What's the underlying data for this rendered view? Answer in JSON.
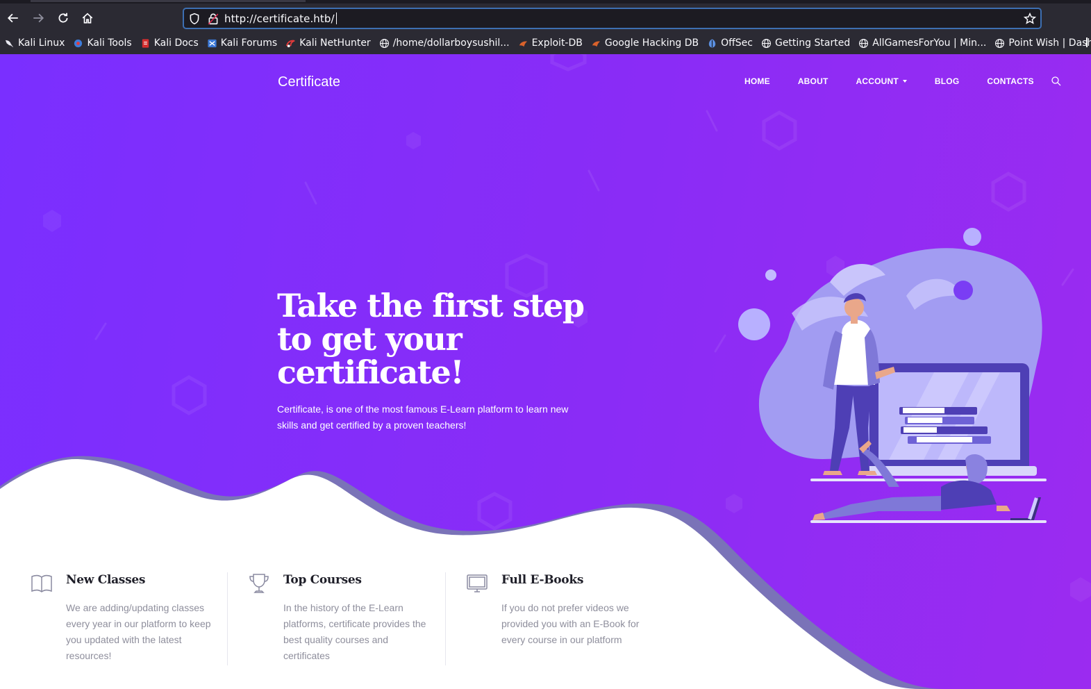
{
  "browser": {
    "url": "http://certificate.htb/",
    "bookmarks": [
      {
        "label": "Kali Linux",
        "icon": "kali-dragon-icon"
      },
      {
        "label": "Kali Tools",
        "icon": "kali-tools-icon"
      },
      {
        "label": "Kali Docs",
        "icon": "kali-docs-icon"
      },
      {
        "label": "Kali Forums",
        "icon": "kali-forums-icon"
      },
      {
        "label": "Kali NetHunter",
        "icon": "kali-nethunter-icon"
      },
      {
        "label": "/home/dollarboysushil...",
        "icon": "globe-icon"
      },
      {
        "label": "Exploit-DB",
        "icon": "exploit-db-icon"
      },
      {
        "label": "Google Hacking DB",
        "icon": "ghdb-icon"
      },
      {
        "label": "OffSec",
        "icon": "offsec-icon"
      },
      {
        "label": "Getting Started",
        "icon": "globe-icon"
      },
      {
        "label": "AllGamesForYou | Min...",
        "icon": "globe-icon"
      },
      {
        "label": "Point Wish | Dashboard",
        "icon": "globe-icon"
      }
    ]
  },
  "site": {
    "brand": "Certificate",
    "nav": {
      "home": "HOME",
      "about": "ABOUT",
      "account": "ACCOUNT",
      "blog": "BLOG",
      "contacts": "CONTACTS"
    },
    "hero": {
      "title_line1": "Take the first step",
      "title_line2": "to get your",
      "title_line3": "certificate!",
      "subtitle": "Certificate, is one of the most famous E-Learn platform to learn new skills and get certified by a proven teachers!"
    },
    "features": [
      {
        "title": "New Classes",
        "icon": "book-icon",
        "text": "We are adding/updating classes every year in our platform to keep you updated with the latest resources!"
      },
      {
        "title": "Top Courses",
        "icon": "trophy-icon",
        "text": "In the history of the E-Learn platforms, certificate provides the best quality courses and certificates"
      },
      {
        "title": "Full E-Books",
        "icon": "monitor-icon",
        "text": "If you do not prefer videos we provided you with an E-Book for every course in our platform"
      }
    ]
  },
  "colors": {
    "hero_gradient_start": "#7a2fff",
    "hero_gradient_end": "#9b2bf0",
    "wave_shadow": "#7a73b8",
    "url_focus_border": "#3d6fb2"
  }
}
